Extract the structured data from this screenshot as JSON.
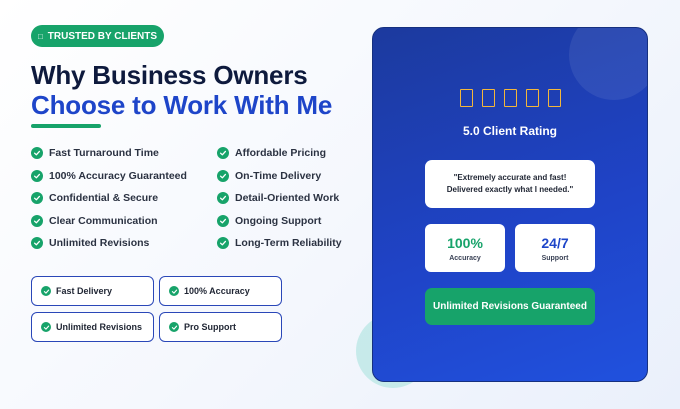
{
  "badge": {
    "icon": "shield-icon",
    "glyph": "□",
    "label": "TRUSTED BY CLIENTS"
  },
  "headline": {
    "line1": "Why Business Owners",
    "line2": "Choose to Work With Me"
  },
  "features": {
    "left": [
      "Fast Turnaround Time",
      "100% Accuracy Guaranteed",
      "Confidential & Secure",
      "Clear Communication",
      "Unlimited Revisions"
    ],
    "right": [
      "Affordable Pricing",
      "On-Time Delivery",
      "Detail-Oriented Work",
      "Ongoing Support",
      "Long-Term Reliability"
    ]
  },
  "chips": [
    "Fast Delivery",
    "100% Accuracy",
    "Unlimited Revisions",
    "Pro Support"
  ],
  "card": {
    "stars": [
      "□",
      "□",
      "□",
      "□",
      "□"
    ],
    "rating": "5.0 Client Rating",
    "quote_line1": "\"Extremely accurate and fast!",
    "quote_line2": "Delivered exactly what I needed.\"",
    "stats": [
      {
        "value": "100%",
        "label": "Accuracy"
      },
      {
        "value": "24/7",
        "label": "Support"
      }
    ],
    "cta": "Unlimited Revisions Guaranteed"
  },
  "colors": {
    "accent_green": "#17a36a",
    "brand_blue": "#1e45c9",
    "headline_dark": "#0e1a3d",
    "star_gold": "#f3b73b"
  }
}
